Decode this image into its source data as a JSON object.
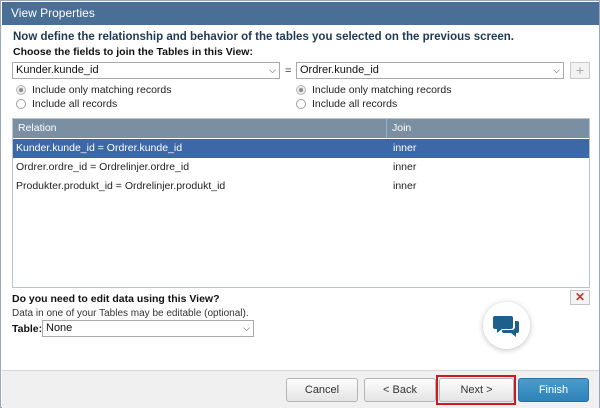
{
  "window": {
    "title": "View Properties"
  },
  "intro": {
    "heading": "Now define the relationship and behavior of the tables you selected on the previous screen.",
    "subheading": "Choose the fields to join the Tables in this View:"
  },
  "join": {
    "left_field": "Kunder.kunde_id",
    "operator": "=",
    "right_field": "Ordrer.kunde_id",
    "add_label": "+",
    "left_options": [
      {
        "label": "Include only matching records",
        "checked": true
      },
      {
        "label": "Include all records",
        "checked": false
      }
    ],
    "right_options": [
      {
        "label": "Include only matching records",
        "checked": true
      },
      {
        "label": "Include all records",
        "checked": false
      }
    ]
  },
  "relations": {
    "columns": {
      "relation": "Relation",
      "join": "Join"
    },
    "rows": [
      {
        "relation": "Kunder.kunde_id = Ordrer.kunde_id",
        "join": "inner",
        "selected": true
      },
      {
        "relation": "Ordrer.ordre_id = Ordrelinjer.ordre_id",
        "join": "inner",
        "selected": false
      },
      {
        "relation": "Produkter.produkt_id = Ordrelinjer.produkt_id",
        "join": "inner",
        "selected": false
      }
    ]
  },
  "edit": {
    "question": "Do you need to edit data using this View?",
    "note": "Data in one of your Tables may be editable (optional).",
    "table_label": "Table:",
    "table_value": "None",
    "remove_label": "✕"
  },
  "footer": {
    "cancel": "Cancel",
    "back": "< Back",
    "next": "Next >",
    "finish": "Finish"
  },
  "colors": {
    "titlebar": "#4a6f96",
    "grid_header": "#7b8fa3",
    "selected_row": "#3d68a8",
    "finish_button": "#2e82b8",
    "highlight": "#d0171e",
    "chat_icon": "#1f5f8b"
  },
  "icons": {
    "chat": "chat-bubbles-icon",
    "chevron": "chevron-down-icon"
  }
}
